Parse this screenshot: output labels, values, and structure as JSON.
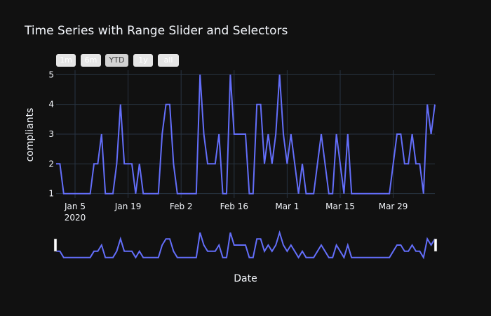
{
  "chart_data": {
    "type": "line",
    "title": "Time Series with Range Slider and Selectors",
    "xlabel": "Date",
    "ylabel": "compliants",
    "ylim": [
      0.85,
      5.15
    ],
    "x_start": "2019-12-31",
    "x_end": "2020-04-09",
    "range_selector": [
      "1m",
      "6m",
      "YTD",
      "1y",
      "all"
    ],
    "range_selector_active": "YTD",
    "range_slider": true,
    "grid": true,
    "line_color": "#636efa",
    "x_ticks": [
      {
        "label": "Jan 5",
        "sub": "2020",
        "date": "2020-01-05"
      },
      {
        "label": "Jan 19",
        "sub": "",
        "date": "2020-01-19"
      },
      {
        "label": "Feb 2",
        "sub": "",
        "date": "2020-02-02"
      },
      {
        "label": "Feb 16",
        "sub": "",
        "date": "2020-02-16"
      },
      {
        "label": "Mar 1",
        "sub": "",
        "date": "2020-03-01"
      },
      {
        "label": "Mar 15",
        "sub": "",
        "date": "2020-03-15"
      },
      {
        "label": "Mar 29",
        "sub": "",
        "date": "2020-03-29"
      }
    ],
    "y_ticks": [
      1,
      2,
      3,
      4,
      5
    ],
    "series": [
      {
        "x": [
          "2019-12-31",
          "2020-01-01",
          "2020-01-02",
          "2020-01-03",
          "2020-01-04",
          "2020-01-05",
          "2020-01-06",
          "2020-01-07",
          "2020-01-08",
          "2020-01-09",
          "2020-01-10",
          "2020-01-11",
          "2020-01-12",
          "2020-01-13",
          "2020-01-14",
          "2020-01-15",
          "2020-01-16",
          "2020-01-17",
          "2020-01-18",
          "2020-01-19",
          "2020-01-20",
          "2020-01-21",
          "2020-01-22",
          "2020-01-23",
          "2020-01-24",
          "2020-01-25",
          "2020-01-26",
          "2020-01-27",
          "2020-01-28",
          "2020-01-29",
          "2020-01-30",
          "2020-01-31",
          "2020-02-01",
          "2020-02-02",
          "2020-02-03",
          "2020-02-04",
          "2020-02-05",
          "2020-02-06",
          "2020-02-07",
          "2020-02-08",
          "2020-02-09",
          "2020-02-10",
          "2020-02-11",
          "2020-02-12",
          "2020-02-13",
          "2020-02-14",
          "2020-02-15",
          "2020-02-16",
          "2020-02-17",
          "2020-02-18",
          "2020-02-19",
          "2020-02-20",
          "2020-02-21",
          "2020-02-22",
          "2020-02-23",
          "2020-02-24",
          "2020-02-25",
          "2020-02-26",
          "2020-02-27",
          "2020-02-28",
          "2020-02-29",
          "2020-03-01",
          "2020-03-02",
          "2020-03-03",
          "2020-03-04",
          "2020-03-05",
          "2020-03-06",
          "2020-03-07",
          "2020-03-08",
          "2020-03-09",
          "2020-03-10",
          "2020-03-11",
          "2020-03-12",
          "2020-03-13",
          "2020-03-14",
          "2020-03-15",
          "2020-03-16",
          "2020-03-17",
          "2020-03-18",
          "2020-03-19",
          "2020-03-20",
          "2020-03-21",
          "2020-03-22",
          "2020-03-23",
          "2020-03-24",
          "2020-03-25",
          "2020-03-26",
          "2020-03-27",
          "2020-03-28",
          "2020-03-29",
          "2020-03-30",
          "2020-03-31",
          "2020-04-01",
          "2020-04-02",
          "2020-04-03",
          "2020-04-04",
          "2020-04-05",
          "2020-04-06",
          "2020-04-07",
          "2020-04-08",
          "2020-04-09"
        ],
        "y": [
          2,
          2,
          1,
          1,
          1,
          1,
          1,
          1,
          1,
          1,
          2,
          2,
          3,
          1,
          1,
          1,
          2,
          4,
          2,
          2,
          2,
          1,
          2,
          1,
          1,
          1,
          1,
          1,
          3,
          4,
          4,
          2,
          1,
          1,
          1,
          1,
          1,
          1,
          5,
          3,
          2,
          2,
          2,
          3,
          1,
          1,
          5,
          3,
          3,
          3,
          3,
          1,
          1,
          4,
          4,
          2,
          3,
          2,
          3,
          5,
          3,
          2,
          3,
          2,
          1,
          2,
          1,
          1,
          1,
          2,
          3,
          2,
          1,
          1,
          3,
          2,
          1,
          3,
          1,
          1,
          1,
          1,
          1,
          1,
          1,
          1,
          1,
          1,
          1,
          2,
          3,
          3,
          2,
          2,
          3,
          2,
          2,
          1,
          4,
          3,
          4
        ]
      }
    ]
  }
}
